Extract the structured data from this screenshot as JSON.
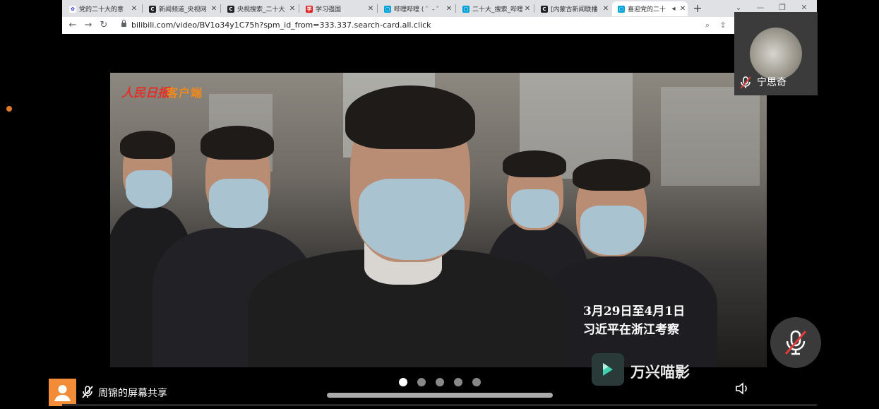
{
  "browser": {
    "tabs": [
      {
        "title": "党的二十大的意",
        "favicon": "baidu-icon",
        "color": "#2932e1"
      },
      {
        "title": "新闻频道_央视网",
        "favicon": "cctv-icon",
        "color": "#222"
      },
      {
        "title": "央视搜索_二十大",
        "favicon": "cctv-icon",
        "color": "#222"
      },
      {
        "title": "学习强国",
        "favicon": "xuexi-icon",
        "color": "#e02020"
      },
      {
        "title": "哔哩哔哩 ( ゜- ゜",
        "favicon": "bilibili-icon",
        "color": "#00a1d6"
      },
      {
        "title": "二十大_搜索_哔哩",
        "favicon": "bilibili-icon",
        "color": "#00a1d6"
      },
      {
        "title": "[内蒙古新闻联播",
        "favicon": "cctv-icon",
        "color": "#222"
      },
      {
        "title": "喜迎党的二十",
        "favicon": "bilibili-icon",
        "color": "#00a1d6",
        "active": true
      }
    ],
    "new_tab": "+",
    "address": "bilibili.com/video/BV1o34y1C75h?spm_id_from=333.337.search-card.all.click"
  },
  "video": {
    "logo_main": "人民日报",
    "logo_sub": "客户端",
    "caption_line1": "3月29日至4月1日",
    "caption_line2": "习近平在浙江考察"
  },
  "watermark": {
    "text": "万兴喵影"
  },
  "participant": {
    "name": "宁思奇",
    "muted": true
  },
  "screen_share": {
    "label": "周锦的屏幕共享",
    "muted": true
  },
  "pager": {
    "count": 5,
    "active": 0
  },
  "colors": {
    "accent_orange": "#f28c38",
    "background": "#000000"
  }
}
